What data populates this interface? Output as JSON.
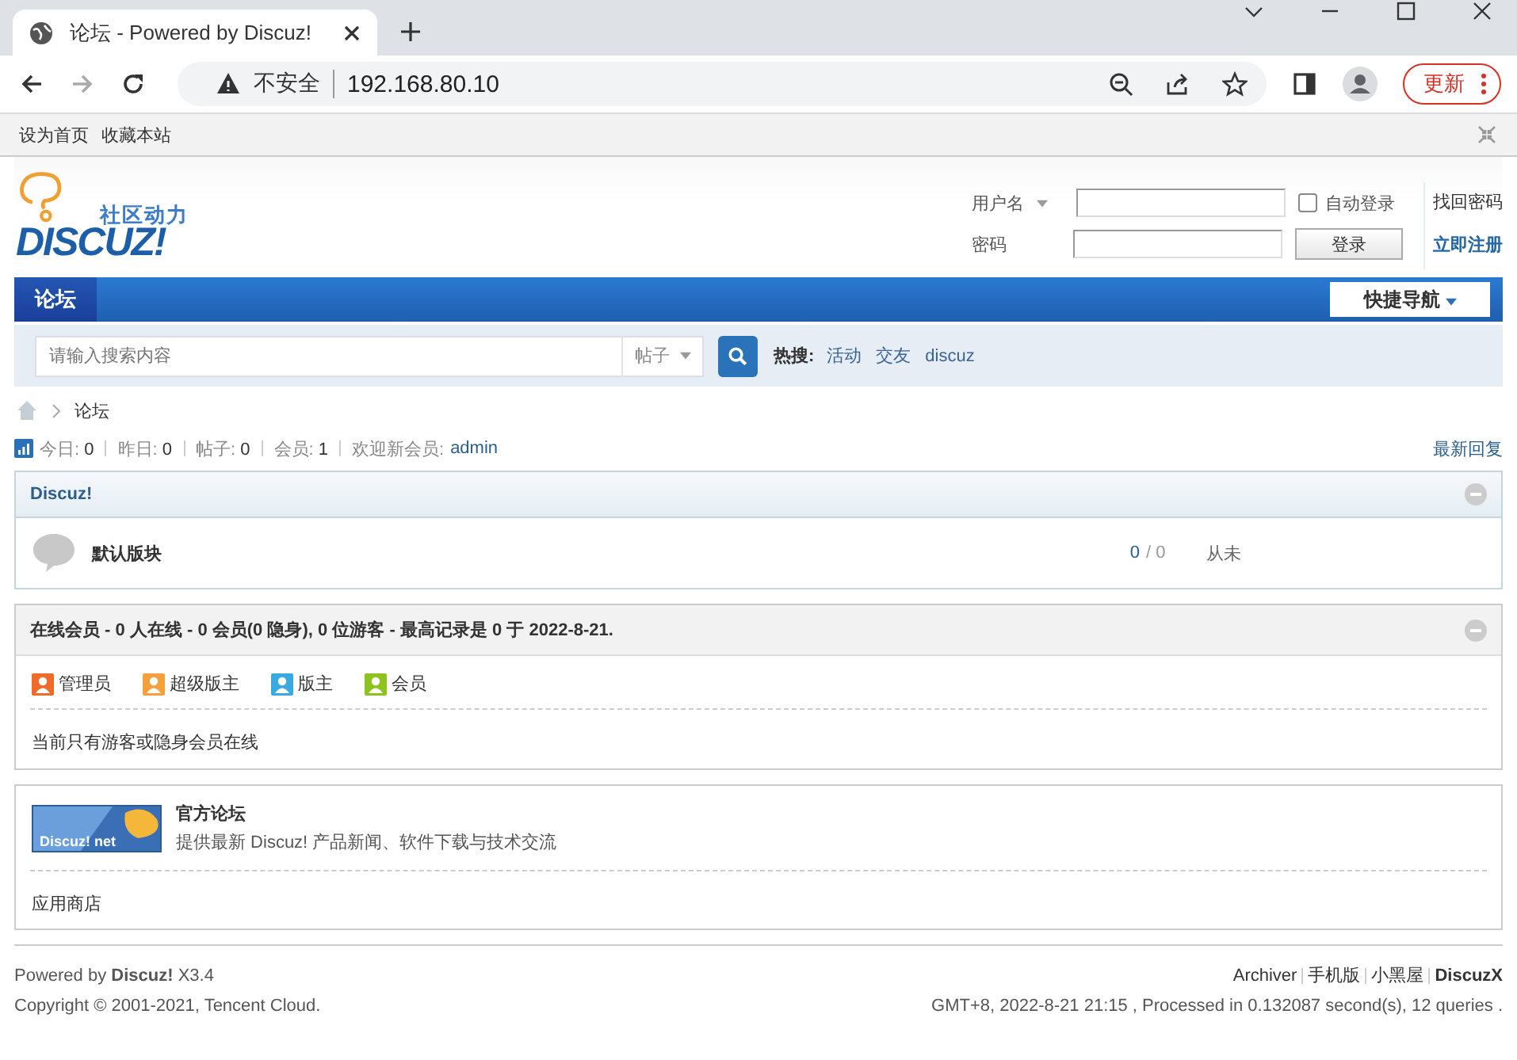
{
  "browser": {
    "tab_title": "论坛 - Powered by Discuz!",
    "security": "不安全",
    "url": "192.168.80.10",
    "update_button": "更新"
  },
  "topbar": {
    "links": [
      "设为首页",
      "收藏本站"
    ]
  },
  "logo": {
    "tagline": "社区动力",
    "wordmark": "DISCUZ!"
  },
  "login": {
    "username_label": "用户名",
    "password_label": "密码",
    "auto_login": {
      "label": "自动登录",
      "checked": false
    },
    "submit": "登录",
    "links": [
      "找回密码",
      "立即注册"
    ]
  },
  "nav": {
    "items": [
      {
        "label": "论坛",
        "selected": true
      }
    ],
    "quick_nav": "快捷导航"
  },
  "search": {
    "placeholder": "请输入搜索内容",
    "type": "帖子",
    "hot_label": "热搜:",
    "hot": [
      "活动",
      "交友",
      "discuz"
    ]
  },
  "breadcrumb": {
    "current": "论坛"
  },
  "stats": {
    "items": [
      {
        "label": "今日:",
        "value": "0"
      },
      {
        "label": "昨日:",
        "value": "0"
      },
      {
        "label": "帖子:",
        "value": "0"
      },
      {
        "label": "会员:",
        "value": "1"
      }
    ],
    "welcome_label": "欢迎新会员:",
    "new_member": "admin",
    "latest": "最新回复"
  },
  "category": {
    "title": "Discuz!",
    "forums": [
      {
        "name": "默认版块",
        "threads": "0",
        "posts": "/ 0",
        "last_post": "从未"
      }
    ]
  },
  "online": {
    "title": "在线会员 - 0 人在线 - 0 会员(0 隐身), 0 位游客 - 最高记录是 0 于 2022-8-21.",
    "legend": [
      {
        "label": "管理员",
        "color": "#f06a2a"
      },
      {
        "label": "超级版主",
        "color": "#f5a03a"
      },
      {
        "label": "版主",
        "color": "#3aa9e0"
      },
      {
        "label": "会员",
        "color": "#8cc31e"
      }
    ],
    "message": "当前只有游客或隐身会员在线"
  },
  "friendlinks": {
    "logo_text": "Discuz! net",
    "title": "官方论坛",
    "description": "提供最新 Discuz! 产品新闻、软件下载与技术交流",
    "app_store": "应用商店"
  },
  "footer": {
    "powered": "Powered by **Discuz!** X3.4",
    "copyright": "Copyright © 2001-2021, Tencent Cloud.",
    "links": [
      {
        "label": "Archiver",
        "bold": false
      },
      {
        "label": "手机版",
        "bold": false
      },
      {
        "label": "小黑屋",
        "bold": false
      },
      {
        "label": "DiscuzX",
        "bold": true
      }
    ],
    "processed": "GMT+8, 2022-8-21 21:15 , Processed in 0.132087 second(s), 12 queries ."
  }
}
